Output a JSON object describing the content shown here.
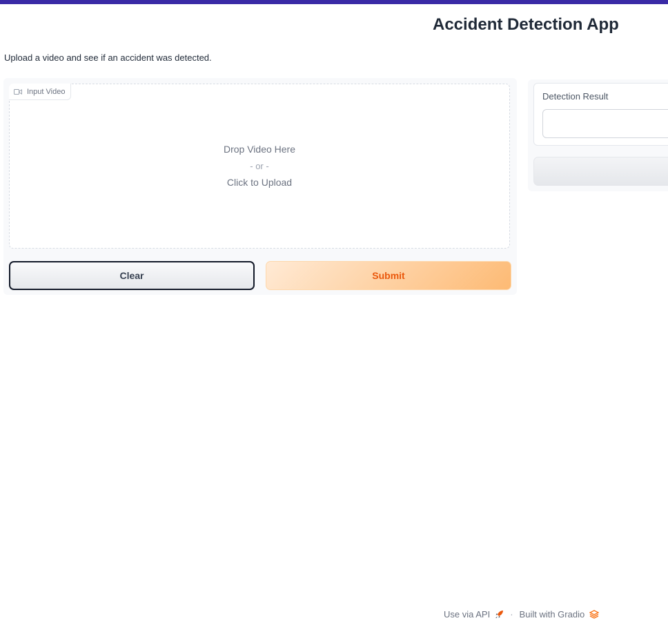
{
  "app": {
    "title": "Accident Detection App",
    "description": "Upload a video and see if an accident was detected."
  },
  "input_video": {
    "label": "Input Video",
    "icon": "video-camera-icon",
    "drop_text": "Drop Video Here",
    "or_text": "- or -",
    "upload_text": "Click to Upload"
  },
  "buttons": {
    "clear_label": "Clear",
    "submit_label": "Submit"
  },
  "output": {
    "label": "Detection Result",
    "value": ""
  },
  "footer": {
    "api_label": "Use via API",
    "api_icon": "rocket-icon",
    "separator": "·",
    "built_label": "Built with Gradio",
    "gradio_icon": "gradio-logo-icon"
  },
  "colors": {
    "top_bar": "#3a2aa6",
    "submit_text": "#ea580c",
    "submit_bg": "#fdba74"
  }
}
